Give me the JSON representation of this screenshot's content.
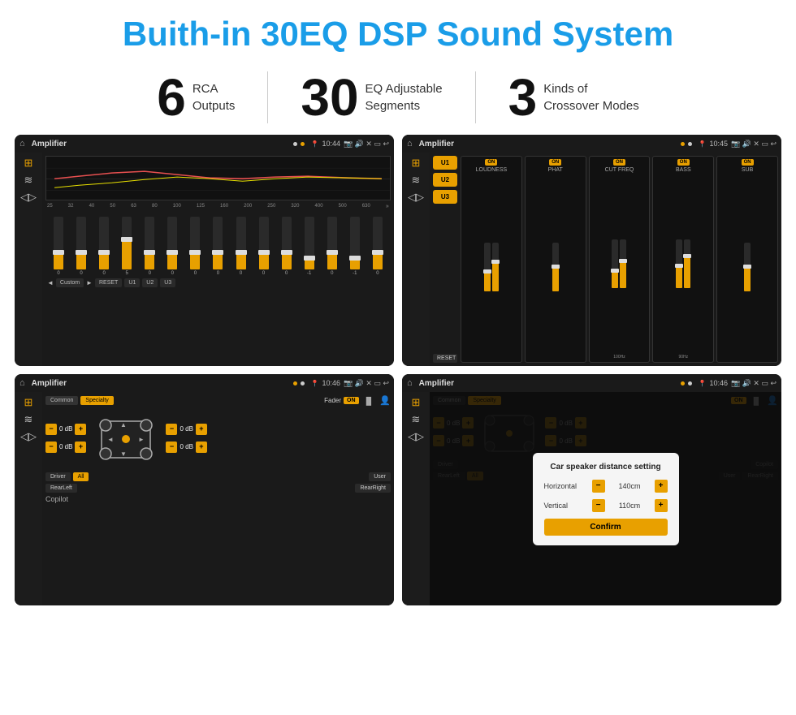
{
  "page": {
    "title": "Buith-in 30EQ DSP Sound System"
  },
  "features": [
    {
      "number": "6",
      "text_line1": "RCA",
      "text_line2": "Outputs"
    },
    {
      "number": "30",
      "text_line1": "EQ Adjustable",
      "text_line2": "Segments"
    },
    {
      "number": "3",
      "text_line1": "Kinds of",
      "text_line2": "Crossover Modes"
    }
  ],
  "screens": [
    {
      "id": "screen-eq",
      "title": "Amplifier",
      "time": "10:44",
      "eq_bands": [
        "25",
        "32",
        "40",
        "50",
        "63",
        "80",
        "100",
        "125",
        "160",
        "200",
        "250",
        "320",
        "400",
        "500",
        "630"
      ],
      "eq_values": [
        0,
        0,
        0,
        5,
        0,
        0,
        0,
        0,
        0,
        0,
        0,
        -1,
        0,
        -1,
        0
      ],
      "eq_heights": [
        30,
        30,
        30,
        50,
        30,
        30,
        30,
        30,
        30,
        30,
        30,
        15,
        30,
        15,
        30
      ],
      "buttons": [
        "Custom",
        "RESET",
        "U1",
        "U2",
        "U3"
      ]
    },
    {
      "id": "screen-crossover",
      "title": "Amplifier",
      "time": "10:45",
      "u_buttons": [
        "U1",
        "U2",
        "U3"
      ],
      "sections": [
        {
          "label": "LOUDNESS",
          "on": true
        },
        {
          "label": "PHAT",
          "on": true
        },
        {
          "label": "CUT FREQ",
          "on": true
        },
        {
          "label": "BASS",
          "on": true
        },
        {
          "label": "SUB",
          "on": true
        }
      ],
      "reset_label": "RESET"
    },
    {
      "id": "screen-fader",
      "title": "Amplifier",
      "time": "10:46",
      "tabs": [
        {
          "label": "Common",
          "active": false
        },
        {
          "label": "Specialty",
          "active": true
        }
      ],
      "fader_label": "Fader",
      "on_label": "ON",
      "db_values": [
        "0 dB",
        "0 dB",
        "0 dB",
        "0 dB"
      ],
      "bottom_buttons": [
        "Driver",
        "RearLeft",
        "All",
        "User",
        "RearRight",
        "Copilot"
      ]
    },
    {
      "id": "screen-distance",
      "title": "Amplifier",
      "time": "10:46",
      "tabs": [
        {
          "label": "Common",
          "active": false
        },
        {
          "label": "Specialty",
          "active": true
        }
      ],
      "dialog": {
        "title": "Car speaker distance setting",
        "rows": [
          {
            "label": "Horizontal",
            "value": "140cm"
          },
          {
            "label": "Vertical",
            "value": "110cm"
          }
        ],
        "confirm_label": "Confirm"
      },
      "db_values": [
        "0 dB",
        "0 dB"
      ],
      "bottom_buttons": [
        "Driver",
        "RearLeft",
        "All",
        "User",
        "RearRight",
        "Copilot"
      ]
    }
  ]
}
